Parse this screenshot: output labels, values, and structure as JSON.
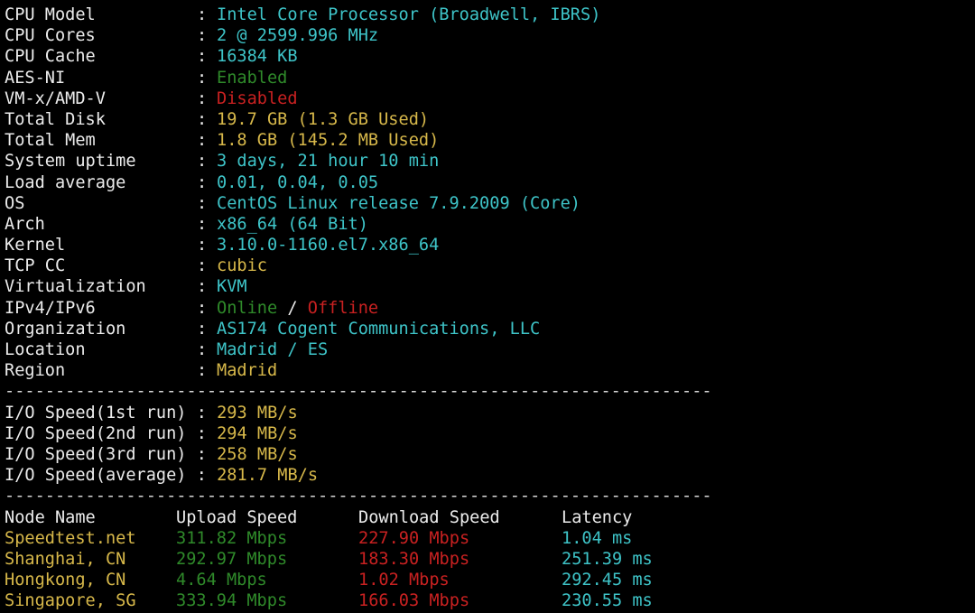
{
  "colors": {
    "background": "#000000",
    "label": "#ececec",
    "cyan": "#3ec4c8",
    "yellow": "#d7b84a",
    "green": "#2f8a2a",
    "red": "#c92121"
  },
  "sysinfo": [
    {
      "key": "CPU Model",
      "sep": ":",
      "value": "Intel Core Processor (Broadwell, IBRS)",
      "color": "cyan"
    },
    {
      "key": "CPU Cores",
      "sep": ":",
      "value": "2 @ 2599.996 MHz",
      "color": "cyan"
    },
    {
      "key": "CPU Cache",
      "sep": ":",
      "value": "16384 KB",
      "color": "cyan"
    },
    {
      "key": "AES-NI",
      "sep": ":",
      "value": "Enabled",
      "color": "green"
    },
    {
      "key": "VM-x/AMD-V",
      "sep": ":",
      "value": "Disabled",
      "color": "red"
    },
    {
      "key": "Total Disk",
      "sep": ":",
      "value": "19.7 GB (1.3 GB Used)",
      "color": "yellow"
    },
    {
      "key": "Total Mem",
      "sep": ":",
      "value": "1.8 GB (145.2 MB Used)",
      "color": "yellow"
    },
    {
      "key": "System uptime",
      "sep": ":",
      "value": "3 days, 21 hour 10 min",
      "color": "cyan"
    },
    {
      "key": "Load average",
      "sep": ":",
      "value": "0.01, 0.04, 0.05",
      "color": "cyan"
    },
    {
      "key": "OS",
      "sep": ":",
      "value": "CentOS Linux release 7.9.2009 (Core)",
      "color": "cyan"
    },
    {
      "key": "Arch",
      "sep": ":",
      "value": "x86_64 (64 Bit)",
      "color": "cyan"
    },
    {
      "key": "Kernel",
      "sep": ":",
      "value": "3.10.0-1160.el7.x86_64",
      "color": "cyan"
    },
    {
      "key": "TCP CC",
      "sep": ":",
      "value": "cubic",
      "color": "yellow"
    },
    {
      "key": "Virtualization",
      "sep": ":",
      "value": "KVM",
      "color": "cyan"
    }
  ],
  "ip": {
    "key": "IPv4/IPv6",
    "sep": ":",
    "v4": "Online",
    "slash": " / ",
    "v6": "Offline"
  },
  "geo": [
    {
      "key": "Organization",
      "sep": ":",
      "value": "AS174 Cogent Communications, LLC",
      "color": "cyan"
    },
    {
      "key": "Location",
      "sep": ":",
      "value": "Madrid / ES",
      "color": "cyan"
    },
    {
      "key": "Region",
      "sep": ":",
      "value": "Madrid",
      "color": "yellow"
    }
  ],
  "separator": "----------------------------------------------------------------------",
  "io": [
    {
      "key": "I/O Speed(1st run) ",
      "sep": ":",
      "value": "293 MB/s"
    },
    {
      "key": "I/O Speed(2nd run) ",
      "sep": ":",
      "value": "294 MB/s"
    },
    {
      "key": "I/O Speed(3rd run) ",
      "sep": ":",
      "value": "258 MB/s"
    },
    {
      "key": "I/O Speed(average) ",
      "sep": ":",
      "value": "281.7 MB/s"
    }
  ],
  "speedtest": {
    "headers": [
      "Node Name",
      "Upload Speed",
      "Download Speed",
      "Latency"
    ],
    "rows": [
      {
        "node": "Speedtest.net",
        "upload": "311.82 Mbps",
        "download": "227.90 Mbps",
        "latency": "1.04 ms"
      },
      {
        "node": "Shanghai, CN",
        "upload": "292.97 Mbps",
        "download": "183.30 Mbps",
        "latency": "251.39 ms"
      },
      {
        "node": "Hongkong, CN",
        "upload": "4.64 Mbps",
        "download": "1.02 Mbps",
        "latency": "292.45 ms"
      },
      {
        "node": "Singapore, SG",
        "upload": "333.94 Mbps",
        "download": "166.03 Mbps",
        "latency": "230.55 ms"
      }
    ]
  }
}
